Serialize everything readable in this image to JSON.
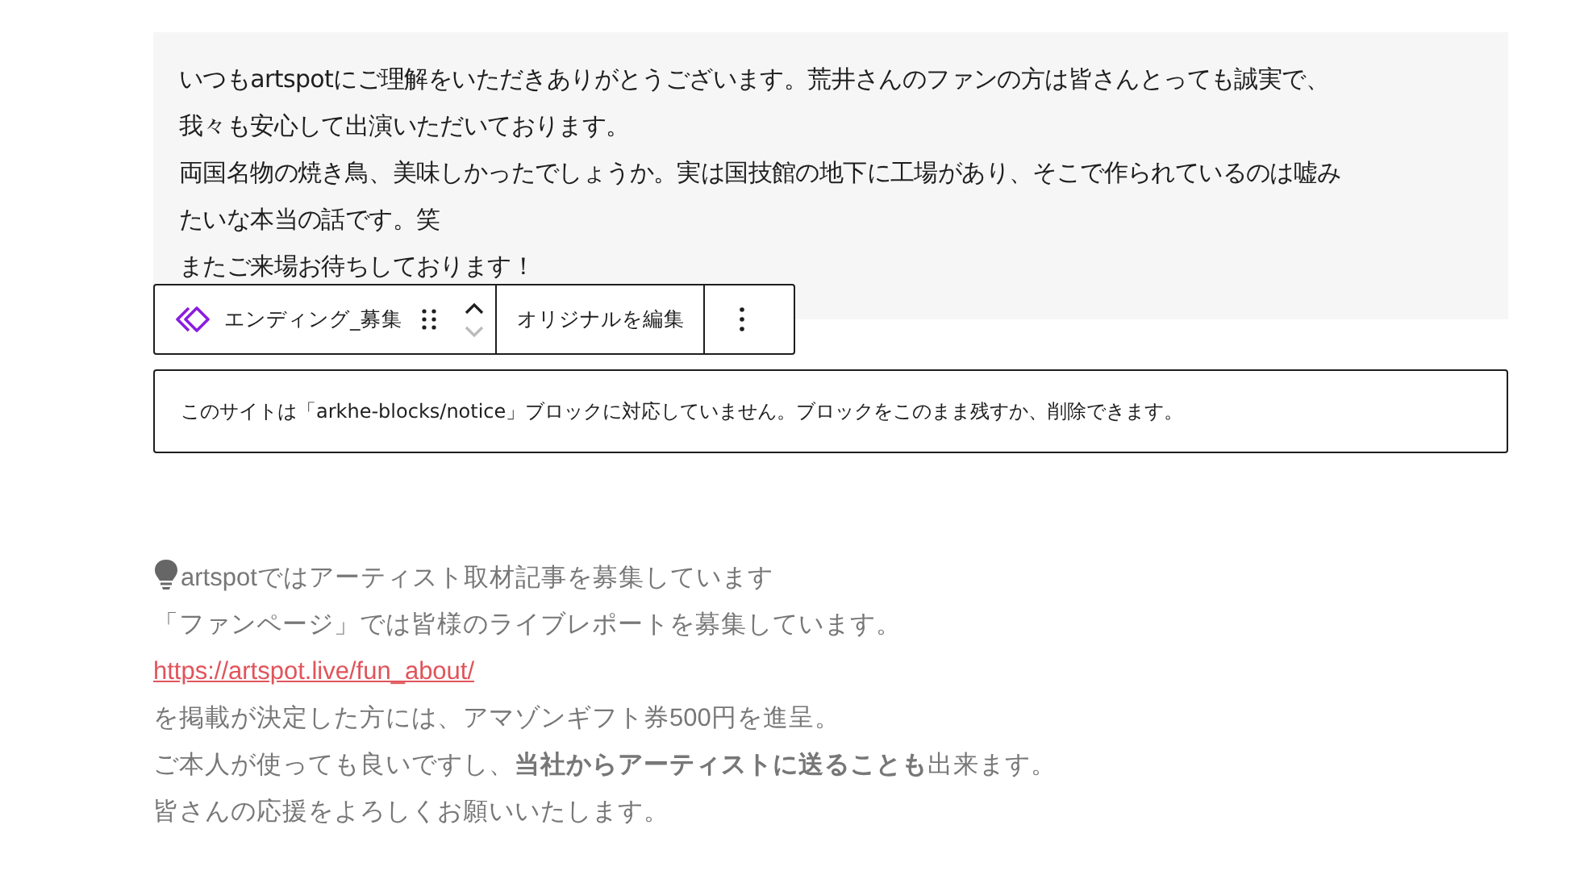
{
  "message_block": {
    "lines": [
      "いつもartspotにご理解をいただきありがとうございます。荒井さんのファンの方は皆さんとっても誠実で、",
      "我々も安心して出演いただいております。",
      "両国名物の焼き鳥、美味しかったでしょうか。実は国技館の地下に工場があり、そこで作られているのは嘘み",
      "たいな本当の話です。笑",
      "またご来場お待ちしております！"
    ]
  },
  "toolbar": {
    "block_name": "エンディング_募集",
    "move_up": {
      "disabled": false
    },
    "move_down": {
      "disabled": true
    },
    "edit_button": "オリジナルを編集"
  },
  "notice": "このサイトは「arkhe-blocks/notice」ブロックに対応していません。ブロックをこのまま残すか、削除できます。",
  "recruit": [
    {
      "kind": "heading",
      "text": "artspotではアーティスト取材記事を募集しています"
    },
    {
      "kind": "text",
      "text": "「ファンページ」では皆様のライブレポートを募集しています。"
    },
    {
      "kind": "link",
      "text": "https://artspot.live/fun_about/"
    },
    {
      "kind": "text",
      "text": "を掲載が決定した方には、アマゾンギフト券500円を進呈。"
    },
    {
      "kind": "text",
      "text": "ご本人が使っても良いですし、**当社からアーティストに送ることも**出来ます。"
    },
    {
      "kind": "text",
      "text": "皆さんの応援をよろしくお願いいたします。"
    }
  ]
}
